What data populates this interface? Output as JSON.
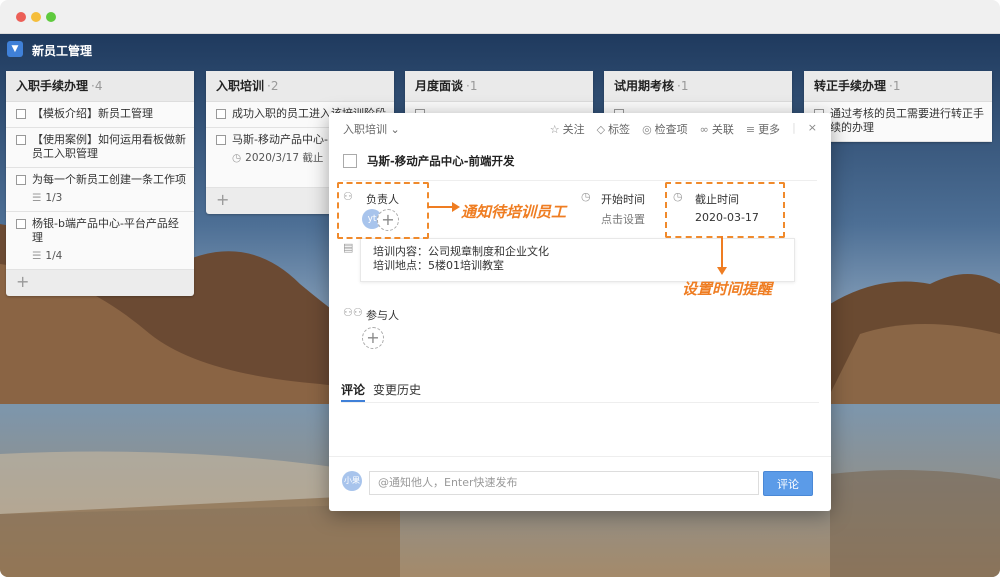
{
  "app": {
    "title": "新员工管理",
    "logo_icon": "chevron-down-icon"
  },
  "columns": [
    {
      "title": "入职手续办理",
      "count": "4",
      "cards": [
        {
          "text": "【模板介绍】新员工管理",
          "meta": ""
        },
        {
          "text": "【使用案例】如何运用看板做新员工入职管理",
          "meta": ""
        },
        {
          "text": "为每一个新员工创建一条工作项",
          "meta": "1/3"
        },
        {
          "text": "杨银-b端产品中心-平台产品经理",
          "meta": "1/4"
        }
      ],
      "add": "+"
    },
    {
      "title": "入职培训",
      "count": "2",
      "cards": [
        {
          "text": "成功入职的员工进入该培训阶段",
          "meta": ""
        },
        {
          "text": "马斯-移动产品中心-",
          "meta": "2020/3/17 截止"
        }
      ],
      "add": "+"
    },
    {
      "title": "月度面谈",
      "count": "1",
      "cards": [
        {
          "text": "…",
          "meta": ""
        }
      ]
    },
    {
      "title": "试用期考核",
      "count": "1",
      "cards": [
        {
          "text": "…",
          "meta": ""
        }
      ]
    },
    {
      "title": "转正手续办理",
      "count": "1",
      "cards": [
        {
          "text": "通过考核的员工需要进行转正手续的办理",
          "meta": ""
        }
      ]
    }
  ],
  "modal": {
    "breadcrumb": "入职培训",
    "actions": [
      {
        "icon": "star-icon",
        "glyph": "☆",
        "label": "关注"
      },
      {
        "icon": "tag-icon",
        "glyph": "◇",
        "label": "标签"
      },
      {
        "icon": "eye-icon",
        "glyph": "◎",
        "label": "检查项"
      },
      {
        "icon": "link-icon",
        "glyph": "∞",
        "label": "关联"
      },
      {
        "icon": "more-icon",
        "glyph": "≡",
        "label": "更多"
      }
    ],
    "close": "×",
    "task_title": "马斯-移动产品中心-前端开发",
    "assignee_label": "负责人",
    "assignee_avatar": "yt",
    "start_label": "开始时间",
    "start_value": "点击设置",
    "due_label": "截止时间",
    "due_value": "2020-03-17",
    "description": "培训内容：公司规章制度和企业文化\n培训地点：5楼01培训教室",
    "participants_label": "参与人",
    "tabs": [
      "评论",
      "变更历史"
    ],
    "comment_avatar": "小果",
    "comment_placeholder": "@通知他人，Enter快速发布",
    "comment_button": "评论"
  },
  "annotations": {
    "notify": "通知待培训员工",
    "reminder": "设置时间提醒",
    "color": "#ef7d22"
  }
}
